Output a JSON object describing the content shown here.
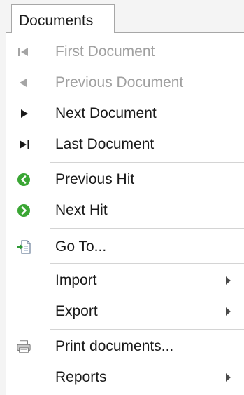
{
  "tab": {
    "label": "Documents"
  },
  "menu": {
    "items": [
      {
        "label": "First Document",
        "icon": "first-document-icon",
        "enabled": false
      },
      {
        "label": "Previous Document",
        "icon": "previous-document-icon",
        "enabled": false
      },
      {
        "label": "Next Document",
        "icon": "next-document-icon",
        "enabled": true
      },
      {
        "label": "Last Document",
        "icon": "last-document-icon",
        "enabled": true
      },
      {
        "label": "Previous Hit",
        "icon": "previous-hit-icon",
        "enabled": true
      },
      {
        "label": "Next Hit",
        "icon": "next-hit-icon",
        "enabled": true
      },
      {
        "label": "Go To...",
        "icon": "go-to-icon",
        "enabled": true
      },
      {
        "label": "Import",
        "icon": "submenu-arrow-icon",
        "enabled": true,
        "submenu": true
      },
      {
        "label": "Export",
        "icon": "submenu-arrow-icon",
        "enabled": true,
        "submenu": true
      },
      {
        "label": "Print documents...",
        "icon": "printer-icon",
        "enabled": true
      },
      {
        "label": "Reports",
        "icon": "submenu-arrow-icon",
        "enabled": true,
        "submenu": true
      }
    ]
  },
  "colors": {
    "hit_green": "#3aa634",
    "disabled_text": "#a0a0a0",
    "text": "#1a1a1a"
  }
}
